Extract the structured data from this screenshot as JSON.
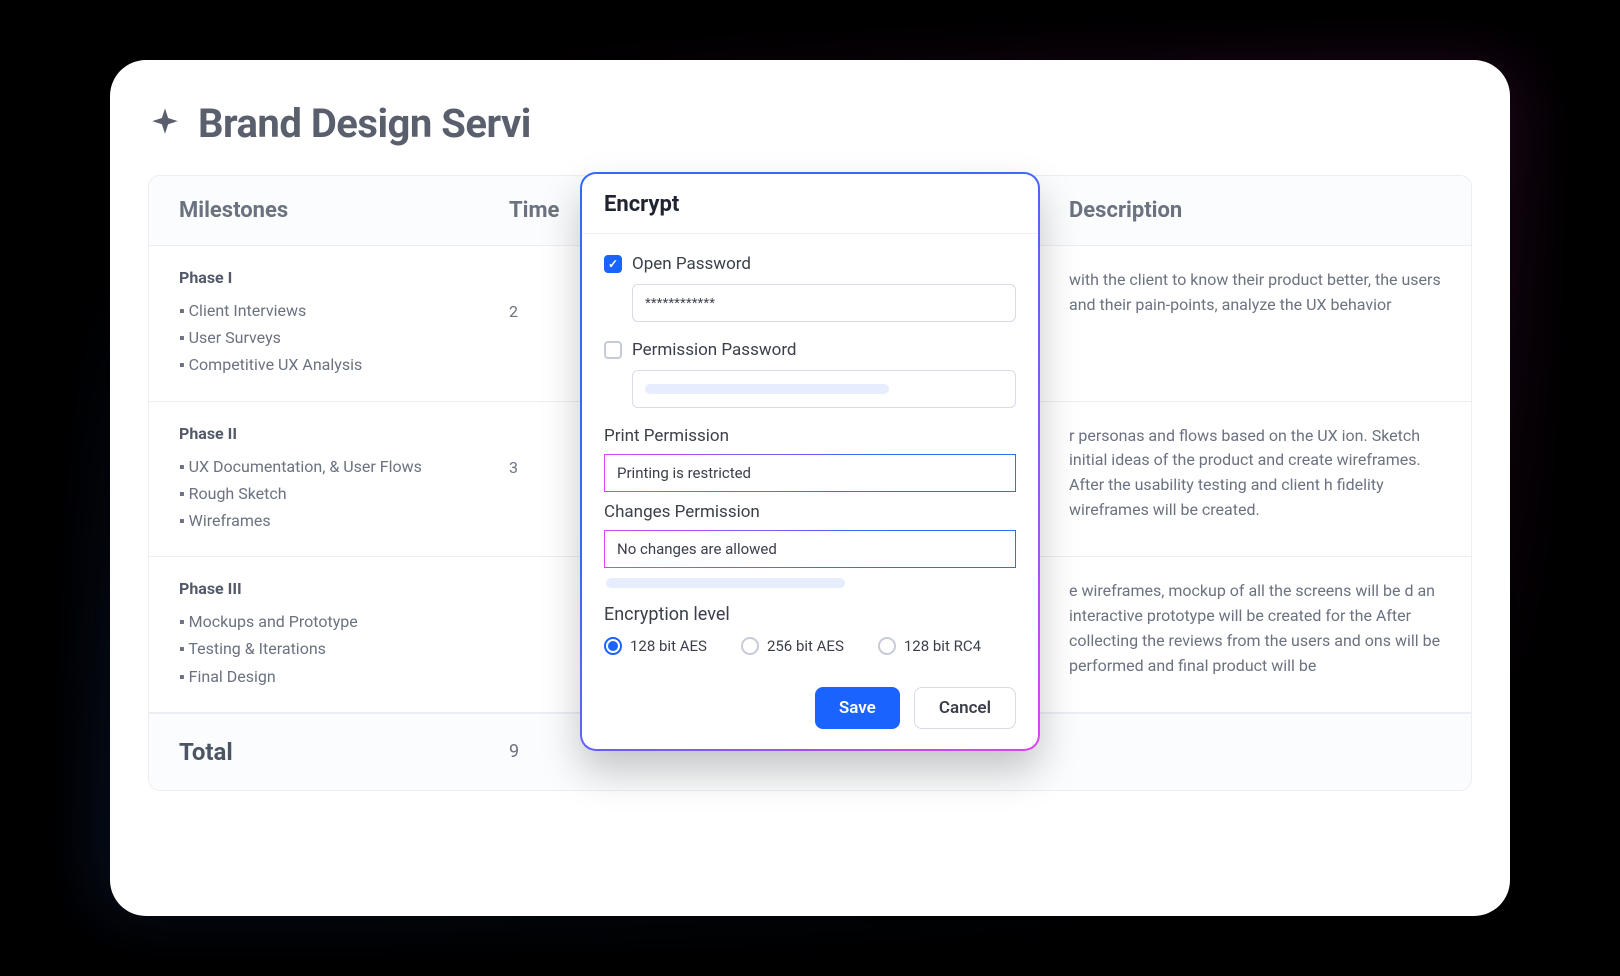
{
  "page": {
    "title": "Brand Design Servi"
  },
  "table": {
    "headers": {
      "milestones": "Milestones",
      "timeline": "Time",
      "description": "Description"
    },
    "rows": [
      {
        "label": "Phase I",
        "items": [
          "Client Interviews",
          "User Surveys",
          "Competitive UX Analysis"
        ],
        "timeline": "2",
        "description": "with the client to know their product better, the users and their pain-points, analyze the UX behavior"
      },
      {
        "label": "Phase II",
        "items": [
          "UX Documentation, & User Flows",
          "Rough Sketch",
          "Wireframes"
        ],
        "timeline": "3",
        "description": "r personas and flows based on the UX ion. Sketch initial ideas of the product and create wireframes. After the usability testing and client h fidelity wireframes will be created."
      },
      {
        "label": "Phase III",
        "items": [
          "Mockups and Prototype",
          "Testing & Iterations",
          "Final Design"
        ],
        "timeline": "",
        "description": "e wireframes, mockup of all the screens will be d an interactive prototype will be created for the After collecting the reviews from the users and ons will be performed and final product will be"
      }
    ],
    "footer": {
      "label": "Total",
      "value": "9"
    }
  },
  "encrypt_modal": {
    "title": "Encrypt",
    "open_password": {
      "label": "Open Password",
      "checked": true,
      "value": "************"
    },
    "permission_password": {
      "label": "Permission Password",
      "checked": false,
      "value": ""
    },
    "print_permission": {
      "label": "Print Permission",
      "value": "Printing is restricted"
    },
    "changes_permission": {
      "label": "Changes Permission",
      "value": "No changes are allowed"
    },
    "encryption_level": {
      "label": "Encryption level",
      "options": [
        "128 bit AES",
        "256 bit AES",
        "128 bit RC4"
      ],
      "selected": "128 bit AES"
    },
    "save_label": "Save",
    "cancel_label": "Cancel"
  }
}
